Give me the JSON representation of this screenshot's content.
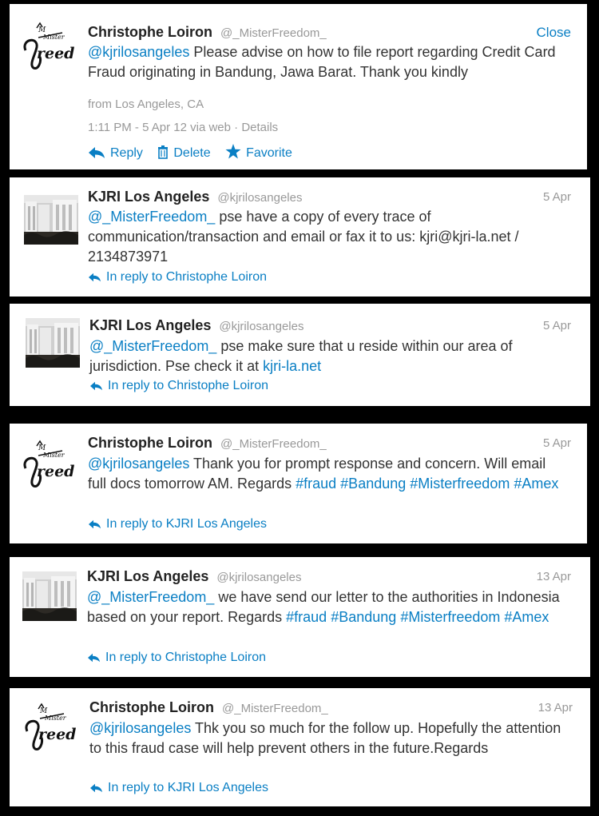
{
  "tweets": [
    {
      "name": "Christophe Loiron",
      "handle": "@_MisterFreedom_",
      "close_label": "Close",
      "text_parts": [
        {
          "text": "@kjrilosangeles",
          "link": true
        },
        {
          "text": " Please advise on how to file report regarding Credit Card Fraud originating in Bandung, Jawa Barat. Thank you kindly",
          "link": false
        }
      ],
      "location": "from Los Angeles, CA",
      "timestamp": "1:11 PM - 5 Apr 12 via web",
      "separator": " · ",
      "details_label": "Details",
      "actions": {
        "reply": "Reply",
        "delete": "Delete",
        "favorite": "Favorite"
      },
      "avatar_icon": "mister-freedom-logo-icon"
    },
    {
      "name": "KJRI Los Angeles",
      "handle": "@kjrilosangeles",
      "date": "5 Apr",
      "text_parts": [
        {
          "text": "@_MisterFreedom_",
          "link": true
        },
        {
          "text": " pse have a copy of every trace of communication/transaction and email or fax it to us: kjri@kjri-la.net / 2134873971",
          "link": false
        }
      ],
      "reply_to": "In reply to Christophe Loiron",
      "avatar_icon": "consulate-building-photo-icon"
    },
    {
      "name": "KJRI Los Angeles",
      "handle": "@kjrilosangeles",
      "date": "5 Apr",
      "text_parts": [
        {
          "text": "@_MisterFreedom_",
          "link": true
        },
        {
          "text": " pse make sure that u reside within our area of jurisdiction. Pse check it at ",
          "link": false
        },
        {
          "text": "kjri-la.net",
          "link": true
        }
      ],
      "reply_to": "In reply to Christophe Loiron",
      "avatar_icon": "consulate-building-photo-icon"
    },
    {
      "name": "Christophe Loiron",
      "handle": "@_MisterFreedom_",
      "date": "5 Apr",
      "text_parts": [
        {
          "text": "@kjrilosangeles",
          "link": true
        },
        {
          "text": " Thank you for prompt response and concern. Will email full docs tomorrow AM. Regards ",
          "link": false
        },
        {
          "text": "#fraud",
          "link": true
        },
        {
          "text": " ",
          "link": false
        },
        {
          "text": "#Bandung",
          "link": true
        },
        {
          "text": " ",
          "link": false
        },
        {
          "text": "#Misterfreedom",
          "link": true
        },
        {
          "text": " ",
          "link": false
        },
        {
          "text": "#Amex",
          "link": true
        }
      ],
      "reply_to": "In reply to KJRI Los Angeles",
      "avatar_icon": "mister-freedom-logo-icon"
    },
    {
      "name": "KJRI Los Angeles",
      "handle": "@kjrilosangeles",
      "date": "13 Apr",
      "text_parts": [
        {
          "text": "@_MisterFreedom_",
          "link": true
        },
        {
          "text": " we have send our letter to the authorities in Indonesia based on your report. Regards ",
          "link": false
        },
        {
          "text": "#fraud",
          "link": true
        },
        {
          "text": " ",
          "link": false
        },
        {
          "text": "#Bandung",
          "link": true
        },
        {
          "text": " ",
          "link": false
        },
        {
          "text": "#Misterfreedom",
          "link": true
        },
        {
          "text": " ",
          "link": false
        },
        {
          "text": "#Amex",
          "link": true
        }
      ],
      "reply_to": "In reply to Christophe Loiron",
      "avatar_icon": "consulate-building-photo-icon"
    },
    {
      "name": "Christophe Loiron",
      "handle": "@_MisterFreedom_",
      "date": "13 Apr",
      "text_parts": [
        {
          "text": "@kjrilosangeles",
          "link": true
        },
        {
          "text": " Thk you so much for the follow up. Hopefully the attention to this fraud case will help prevent others in the future.Regards",
          "link": false
        }
      ],
      "reply_to": "In reply to KJRI Los Angeles",
      "avatar_icon": "mister-freedom-logo-icon"
    }
  ],
  "colors": {
    "link": "#0a7fc4",
    "muted": "#999999",
    "text": "#333333",
    "background": "#000000",
    "card": "#ffffff"
  }
}
